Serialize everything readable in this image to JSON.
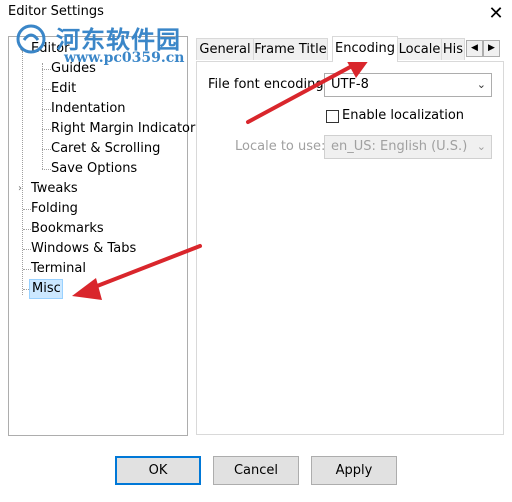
{
  "window": {
    "title": "Editor Settings",
    "close_glyph": "✕"
  },
  "watermark": {
    "title": "河东软件园",
    "url": "www.pc0359.cn"
  },
  "tree": {
    "items": [
      {
        "label": "Editor",
        "children": [
          "Guides",
          "Edit",
          "Indentation",
          "Right Margin Indicator",
          "Caret & Scrolling",
          "Save Options"
        ]
      },
      {
        "label": "Tweaks"
      },
      {
        "label": "Folding"
      },
      {
        "label": "Bookmarks"
      },
      {
        "label": "Windows & Tabs"
      },
      {
        "label": "Terminal"
      },
      {
        "label": "Misc",
        "selected": true
      }
    ]
  },
  "tabs": [
    "General",
    "Frame Title",
    "Encoding",
    "Locale",
    "His"
  ],
  "active_tab": "Encoding",
  "encoding_panel": {
    "file_font_encoding_label": "File font encoding:",
    "file_font_encoding_value": "UTF-8",
    "enable_localization_label": "Enable localization",
    "enable_localization_checked": false,
    "locale_label": "Locale to use:",
    "locale_value": "en_US: English (U.S.)"
  },
  "buttons": {
    "ok": "OK",
    "cancel": "Cancel",
    "apply": "Apply"
  },
  "colors": {
    "annotation_arrow": "#d9262c",
    "selection": "#cce8ff",
    "accent": "#0078d7",
    "watermark": "#3a86c8"
  }
}
